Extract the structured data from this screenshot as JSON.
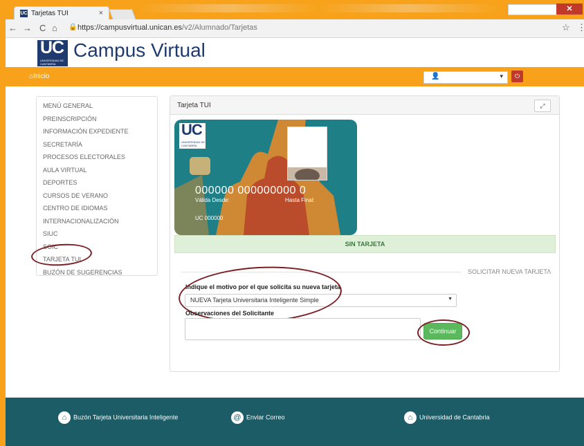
{
  "browser": {
    "tab_title": "Tarjetas TUI",
    "tab_favicon": "UC",
    "url_host": "https://campusvirtual.unican.es",
    "url_path": "/v2/Alumnado/Tarjetas"
  },
  "header": {
    "logo_text": "UC",
    "logo_subtext": "UNIVERSIDAD DE CANTABRIA",
    "site_title": "Campus Virtual"
  },
  "topnav": {
    "home_label": "Inicio",
    "user_select_value": ""
  },
  "sidebar": {
    "items": [
      {
        "label": "MENÚ GENERAL"
      },
      {
        "label": "PREINSCRIPCIÓN"
      },
      {
        "label": "INFORMACIÓN EXPEDIENTE"
      },
      {
        "label": "SECRETARÍA"
      },
      {
        "label": "PROCESOS ELECTORALES"
      },
      {
        "label": "AULA VIRTUAL"
      },
      {
        "label": "DEPORTES"
      },
      {
        "label": "CURSOS DE VERANO"
      },
      {
        "label": "CENTRO DE IDIOMAS"
      },
      {
        "label": "INTERNACIONALIZACIÓN"
      },
      {
        "label": "SIUC"
      },
      {
        "label": "SOIC"
      },
      {
        "label": "TARJETA TUI"
      },
      {
        "label": "BUZÓN DE SUGERENCIAS"
      }
    ]
  },
  "panel": {
    "title": "Tarjeta TUI",
    "card": {
      "logo_text": "UC",
      "logo_subtext": "UNIVERSIDAD DE CANTABRIA",
      "number": "000000 000000000 0",
      "valid_from_label": "Válida Desde:",
      "valid_to_label": "Hasta Final:",
      "code": "UC 000000"
    },
    "status": "SIN TARJETA",
    "section_title": "SOLICITAR NUEVA TARJETA",
    "reason_label": "Indique el motivo por el que solicita su nueva tarjeta",
    "reason_value": "NUEVA Tarjeta Universitaria Inteligente Simple",
    "notes_label": "Observaciones del Solicitante",
    "notes_value": "",
    "continue_button": "Continuar"
  },
  "footer": {
    "links": [
      {
        "label": "Buzón Tarjeta Universitaria Inteligente",
        "icon": "house-icon"
      },
      {
        "label": "Enviar Correo",
        "icon": "at-icon"
      },
      {
        "label": "Universidad de Cantabria",
        "icon": "house-icon"
      }
    ]
  },
  "colors": {
    "orange": "#f7a21a",
    "navy": "#1f3a6e",
    "teal_footer": "#1c5c66",
    "success_green": "#5cb85c",
    "annotation_oval": "#7a1f24"
  }
}
